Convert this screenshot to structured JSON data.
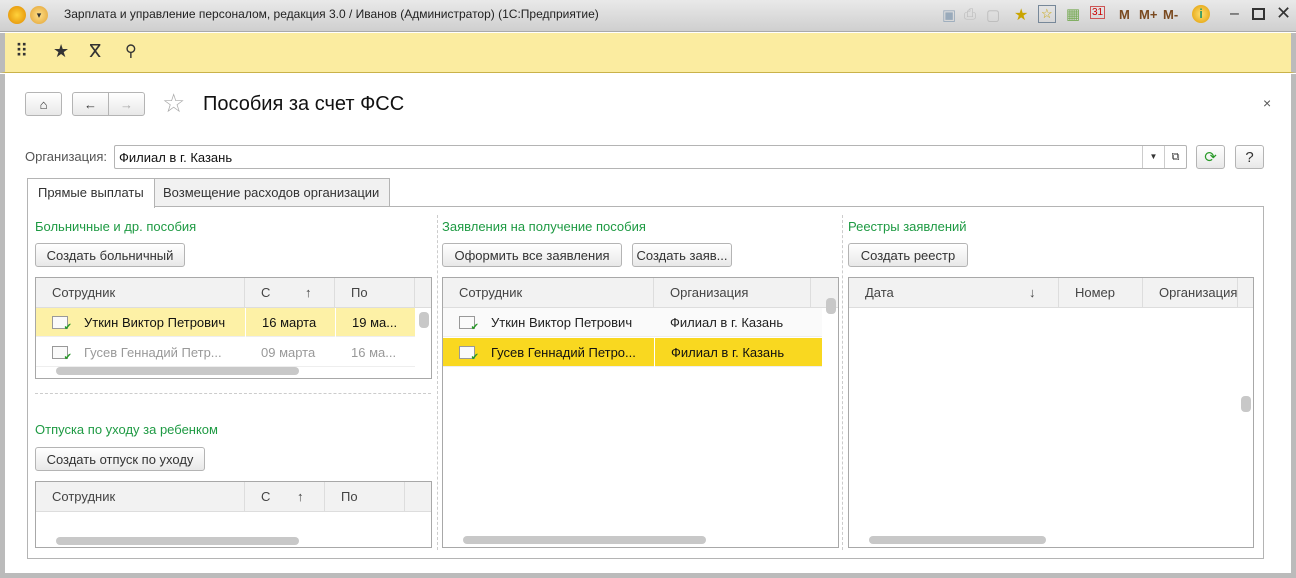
{
  "window": {
    "title": "Зарплата и управление персоналом, редакция 3.0 / Иванов (Администратор)  (1С:Предприятие)",
    "logo": "1С",
    "memory_buttons": [
      "M",
      "M+",
      "M-"
    ]
  },
  "form": {
    "title": "Пособия за счет ФСС",
    "org_label": "Организация:",
    "org_value": "Филиал в г. Казань",
    "help": "?"
  },
  "tabs": [
    {
      "label": "Прямые выплаты",
      "active": true
    },
    {
      "label": "Возмещение расходов организации",
      "active": false
    }
  ],
  "sick": {
    "title": "Больничные и др. пособия",
    "button": "Создать больничный",
    "columns": [
      "Сотрудник",
      "С",
      "По"
    ],
    "sort_icon": "↑",
    "rows": [
      {
        "employee": "Уткин Виктор Петрович",
        "from": "16 марта",
        "to": "19 ма..."
      },
      {
        "employee": "Гусев Геннадий Петр...",
        "from": "09 марта",
        "to": "16 ма..."
      }
    ]
  },
  "leave": {
    "title": "Отпуска по уходу за ребенком",
    "button": "Создать отпуск по уходу",
    "columns": [
      "Сотрудник",
      "С",
      "По"
    ],
    "sort_icon": "↑"
  },
  "applications": {
    "title": "Заявления на получение пособия",
    "button1": "Оформить все заявления",
    "button2": "Создать заяв...",
    "columns": [
      "Сотрудник",
      "Организация"
    ],
    "rows": [
      {
        "employee": "Уткин Виктор Петрович",
        "org": "Филиал в г. Казань"
      },
      {
        "employee": "Гусев Геннадий Петро...",
        "org": "Филиал в г. Казань"
      }
    ]
  },
  "registers": {
    "title": "Реестры заявлений",
    "button": "Создать реестр",
    "columns": [
      "Дата",
      "Номер",
      "Организация"
    ],
    "sort_icon": "↓"
  },
  "colors": {
    "accent_yellow": "#fbeca0",
    "selected_row": "#f9d820",
    "current_row": "#fdf1a6",
    "section_title": "#1e9a43"
  }
}
